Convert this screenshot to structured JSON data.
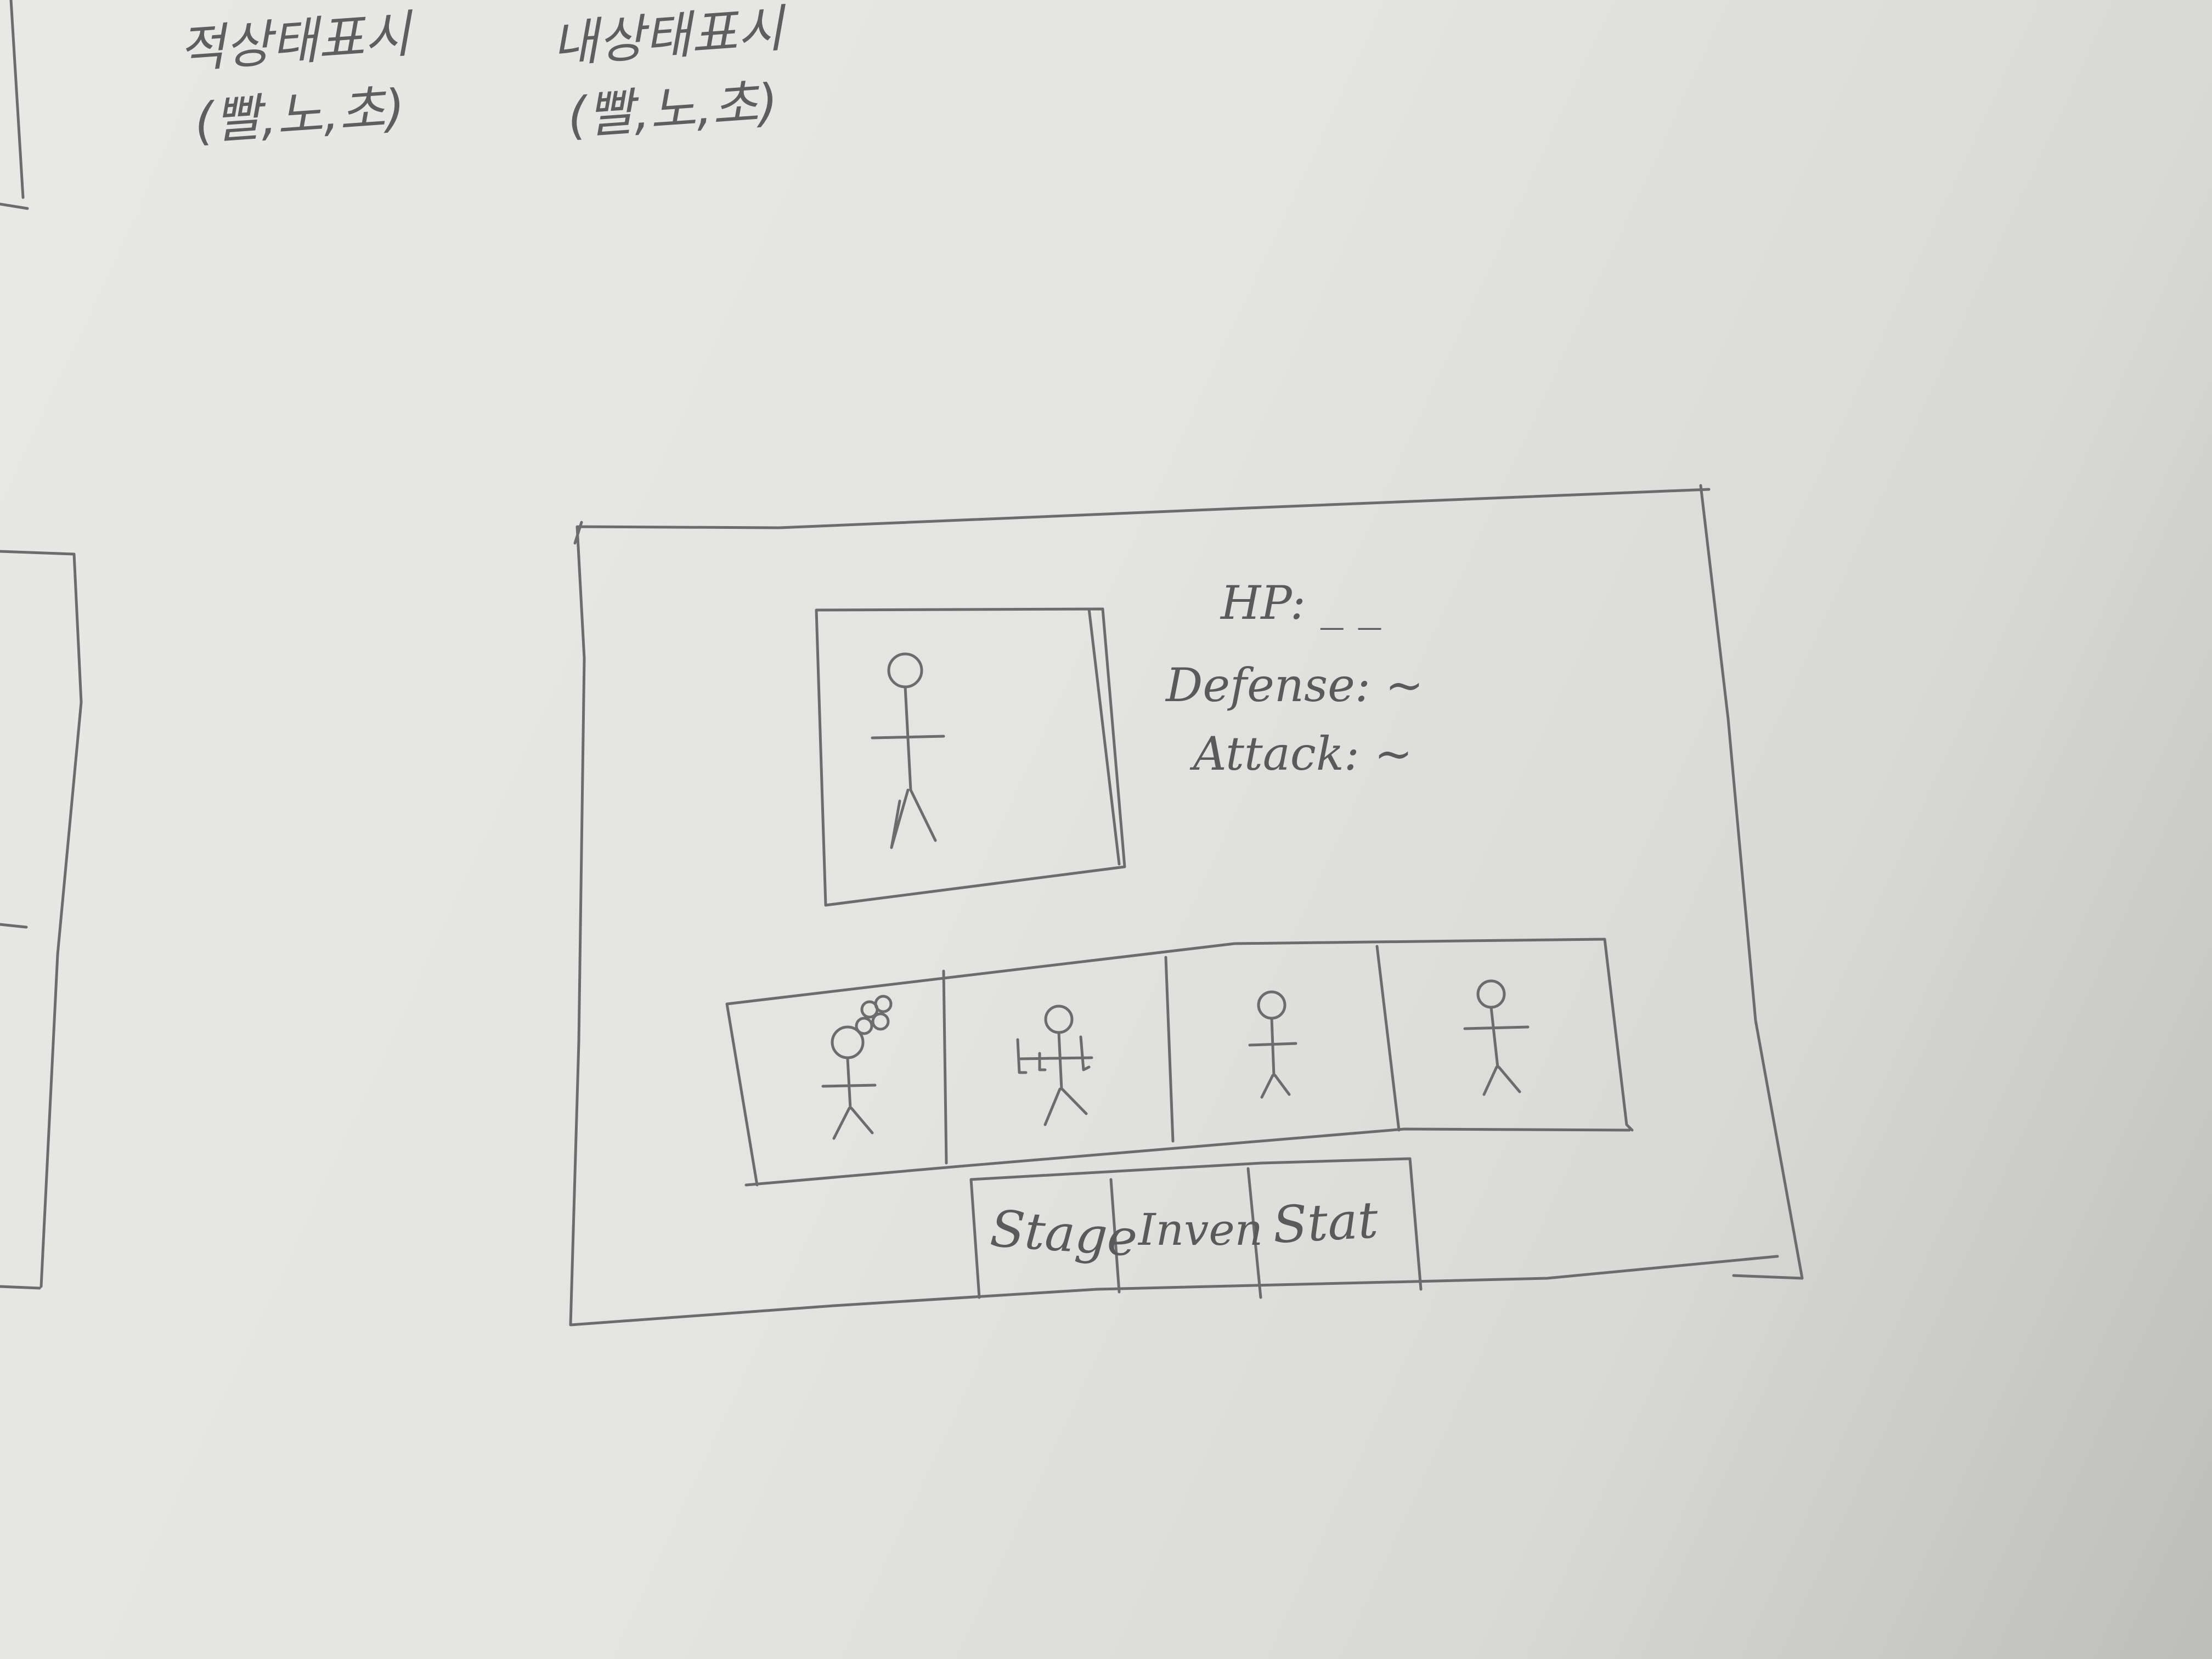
{
  "notes": {
    "enemy_status": {
      "line1": "적상태표시",
      "line2": "(빨,노,초)"
    },
    "my_status": {
      "line1": "내상태표시",
      "line2": "(빨,노,초)"
    }
  },
  "stats": {
    "hp": "HP: _ _",
    "defense": "Defense: ~",
    "attack": "Attack: ~"
  },
  "tabs": [
    "Stage",
    "Inven",
    "Stat"
  ],
  "character_slots": [
    {
      "icon": "character-with-flower-hat-icon"
    },
    {
      "icon": "character-with-weapons-icon"
    },
    {
      "icon": "stick-figure-icon"
    },
    {
      "icon": "stick-figure-icon"
    }
  ],
  "portrait": {
    "icon": "stick-figure-icon"
  }
}
